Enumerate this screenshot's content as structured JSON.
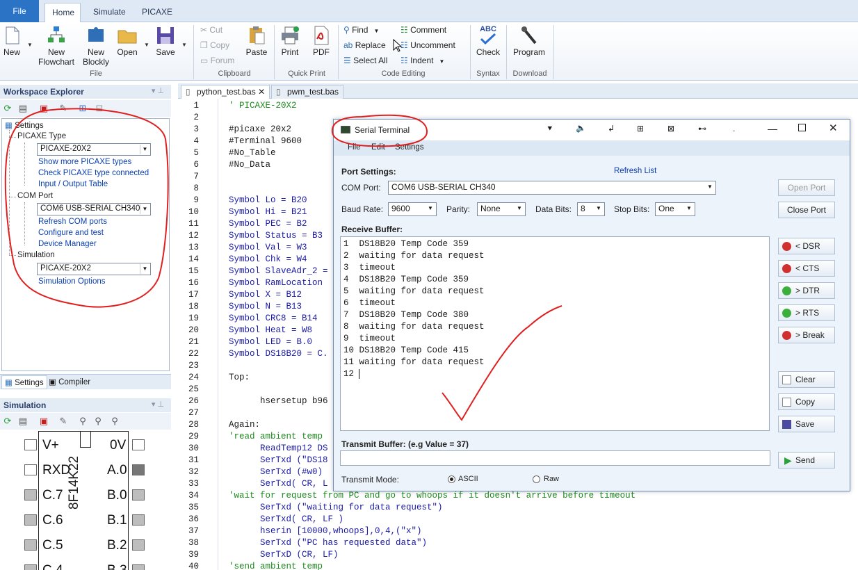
{
  "ribbon": {
    "tabs": [
      "File",
      "Home",
      "Simulate",
      "PICAXE"
    ],
    "new": "New",
    "new_flowchart": [
      "New",
      "Flowchart"
    ],
    "new_blockly": [
      "New",
      "Blockly"
    ],
    "open": "Open",
    "save": "Save",
    "cut": "Cut",
    "copy": "Copy",
    "forum": "Forum",
    "paste": "Paste",
    "print": "Print",
    "pdf": "PDF",
    "find": "Find",
    "replace": "Replace",
    "select_all": "Select All",
    "comment": "Comment",
    "uncomment": "Uncomment",
    "indent": "Indent",
    "check": "Check",
    "program": "Program",
    "groups": {
      "file": "File",
      "clipboard": "Clipboard",
      "quick_print": "Quick Print",
      "code_editing": "Code Editing",
      "syntax": "Syntax",
      "download": "Download"
    },
    "abc": "ABC"
  },
  "workspace": {
    "title": "Workspace Explorer",
    "settings": "Settings",
    "picaxe_type": "PICAXE Type",
    "picaxe_value": "PICAXE-20X2",
    "show_more": "Show more PICAXE types",
    "check_connected": "Check PICAXE type connected",
    "io_table": "Input / Output Table",
    "com_port": "COM Port",
    "com_value": "COM6 USB-SERIAL CH340",
    "refresh_com": "Refresh COM ports",
    "configure": "Configure and test",
    "device_manager": "Device Manager",
    "simulation": "Simulation",
    "sim_value": "PICAXE-20X2",
    "sim_options": "Simulation Options",
    "tab_settings": "Settings",
    "tab_compiler": "Compiler"
  },
  "simulation_pane": {
    "title": "Simulation",
    "chip_name": "8F14K22",
    "left_pins": [
      "V+",
      "RXD",
      "C.7",
      "C.6",
      "C.5",
      "C.4"
    ],
    "right_pins": [
      "0V",
      "A.0",
      "B.0",
      "B.1",
      "B.2",
      "B.3"
    ]
  },
  "editor": {
    "tabs": [
      "python_test.bas",
      "pwm_test.bas"
    ],
    "lines": [
      {
        "n": "1",
        "t": "' PICAXE-20X2",
        "c": "comment"
      },
      {
        "n": "2",
        "t": "",
        "c": "code"
      },
      {
        "n": "3",
        "t": "#picaxe 20x2",
        "c": "code"
      },
      {
        "n": "4",
        "t": "#Terminal 9600",
        "c": "code"
      },
      {
        "n": "5",
        "t": "#No_Table",
        "c": "code"
      },
      {
        "n": "6",
        "t": "#No_Data",
        "c": "code"
      },
      {
        "n": "7",
        "t": "",
        "c": "code"
      },
      {
        "n": "8",
        "t": "",
        "c": "code"
      },
      {
        "n": "9",
        "t": "Symbol Lo = B20",
        "c": "sym"
      },
      {
        "n": "10",
        "t": "Symbol Hi = B21",
        "c": "sym"
      },
      {
        "n": "11",
        "t": "Symbol PEC = B2",
        "c": "sym"
      },
      {
        "n": "12",
        "t": "Symbol Status = B3",
        "c": "sym"
      },
      {
        "n": "13",
        "t": "Symbol Val = W3",
        "c": "sym"
      },
      {
        "n": "14",
        "t": "Symbol Chk = W4",
        "c": "sym"
      },
      {
        "n": "15",
        "t": "Symbol SlaveAdr_2 =",
        "c": "sym"
      },
      {
        "n": "16",
        "t": "Symbol RamLocation",
        "c": "sym"
      },
      {
        "n": "17",
        "t": "Symbol X = B12",
        "c": "sym"
      },
      {
        "n": "18",
        "t": "Symbol N = B13",
        "c": "sym"
      },
      {
        "n": "19",
        "t": "Symbol CRC8 = B14",
        "c": "sym"
      },
      {
        "n": "20",
        "t": "Symbol Heat = W8",
        "c": "sym"
      },
      {
        "n": "21",
        "t": "Symbol LED = B.0",
        "c": "sym"
      },
      {
        "n": "22",
        "t": "Symbol DS18B20 = C.",
        "c": "sym"
      },
      {
        "n": "23",
        "t": "",
        "c": "code"
      },
      {
        "n": "24",
        "t": "Top:",
        "c": "code"
      },
      {
        "n": "25",
        "t": "",
        "c": "code"
      },
      {
        "n": "26",
        "t": "      hsersetup b96",
        "c": "code"
      },
      {
        "n": "27",
        "t": "",
        "c": "code"
      },
      {
        "n": "28",
        "t": "Again:",
        "c": "code"
      },
      {
        "n": "29",
        "t": "'read ambient temp",
        "c": "comment"
      },
      {
        "n": "30",
        "t": "      ReadTemp12 DS",
        "c": "sym"
      },
      {
        "n": "31",
        "t": "      SerTxd (\"DS18",
        "c": "sym"
      },
      {
        "n": "32",
        "t": "      SerTxd (#w0)",
        "c": "sym"
      },
      {
        "n": "33",
        "t": "      SerTxd( CR, L",
        "c": "sym"
      },
      {
        "n": "34",
        "t": "'wait for request from PC and go to whoops if it doesn't arrive before timeout",
        "c": "comment"
      },
      {
        "n": "35",
        "t": "      SerTxd (\"waiting for data request\")",
        "c": "sym"
      },
      {
        "n": "36",
        "t": "      SerTxd( CR, LF )",
        "c": "sym"
      },
      {
        "n": "37",
        "t": "      hserin [10000,whoops],0,4,(\"x\")",
        "c": "sym"
      },
      {
        "n": "38",
        "t": "      SerTxd (\"PC has requested data\")",
        "c": "sym"
      },
      {
        "n": "39",
        "t": "      SerTxD (CR, LF)",
        "c": "sym"
      },
      {
        "n": "40",
        "t": "'send ambient temp",
        "c": "comment"
      }
    ]
  },
  "terminal": {
    "title": "Serial Terminal",
    "menu": [
      "File",
      "Edit",
      "Settings"
    ],
    "port_settings": "Port Settings:",
    "refresh_list": "Refresh List",
    "com_port_label": "COM Port:",
    "com_port_value": "COM6 USB-SERIAL CH340",
    "baud_label": "Baud Rate:",
    "baud_value": "9600",
    "parity_label": "Parity:",
    "parity_value": "None",
    "databits_label": "Data Bits:",
    "databits_value": "8",
    "stopbits_label": "Stop Bits:",
    "stopbits_value": "One",
    "open_port": "Open Port",
    "close_port": "Close Port",
    "receive_buffer": "Receive Buffer:",
    "receive_lines": [
      "1  DS18B20 Temp Code 359",
      "2  waiting for data request",
      "3  timeout",
      "4  DS18B20 Temp Code 359",
      "5  waiting for data request",
      "6  timeout",
      "7  DS18B20 Temp Code 380",
      "8  waiting for data request",
      "9  timeout",
      "10 DS18B20 Temp Code 415",
      "11 waiting for data request",
      "12 "
    ],
    "signals": [
      {
        "label": "< DSR",
        "color": "#d03030"
      },
      {
        "label": "< CTS",
        "color": "#d03030"
      },
      {
        "label": "> DTR",
        "color": "#3cae3c"
      },
      {
        "label": "> RTS",
        "color": "#3cae3c"
      },
      {
        "label": "> Break",
        "color": "#d03030"
      }
    ],
    "clear": "Clear",
    "copy": "Copy",
    "save": "Save",
    "transmit_label": "Transmit Buffer: (e.g Value = 37)",
    "transmit_value": "",
    "send": "Send",
    "mode_label": "Transmit Mode:",
    "mode_ascii": "ASCII",
    "mode_raw": "Raw"
  },
  "colors": {
    "accent": "#2b73c5",
    "comment": "#1e8a1e",
    "code": "#1a1a1a",
    "annotation": "#e02020"
  }
}
